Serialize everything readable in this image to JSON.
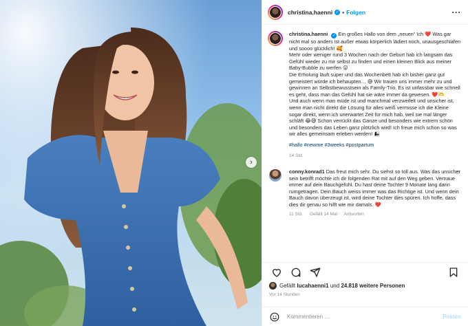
{
  "header": {
    "username": "christina.haenni",
    "separator": "•",
    "follow_label": "Folgen",
    "more_label": "···"
  },
  "caption": {
    "username": "christina.haenni",
    "paragraphs": [
      "Ein großes Hallo von dem „neuen“ Ich ❤️ Was gar nicht mal so anders ist außer etwas körperlich lädiert noch, unausgeschlafen und soooo glücklich! 🥰",
      "Mehr oder weniger rund 3 Wochen nach der Geburt hab ich langsam das Gefühl wieder zu mir selbst zu finden und einen kleinen Blick aus meiner Baby-Bubble zu werfen 😛",
      "Die Erholung läuft super und das Wochenbett hab ich bisher ganz gut gemeistert würde ich behaupten… 😅 Wir trauen uns immer mehr zu und gewinnen an Selbstbewusstsein als Family-Trio. Es ist unfassbar wie schnell es geht, dass man das Gefühl hat sie wäre immer da gewesen. ❤️🫶",
      "Und auch wenn man müde ist und manchmal verzweifelt und unsicher ist, wenn man nicht direkt die Lösung für alles weiß vermisse ich die Kleine sogar direkt, wenn ich unerwartet Zeit für mich hab, weil sie mal länger schläft 😂😅 Schon verrückt das Ganze und besonders wie extrem schön und besonders das Leben ganz plötzlich wird! Ich freue mich schon so was wir alles gemeinsam erleben werden! 👩‍👧"
    ],
    "hashtags": [
      "#hallo",
      "#newme",
      "#3weeks",
      "#postpartum"
    ],
    "time": "14 Std."
  },
  "comment": {
    "username": "conny.konrad1",
    "text": "Das freut mich sehr. Du siehst so toll aus. Was das unsicher sein betrifft möchte ich dir folgenden Rat mit auf den Weg geben. Vertraue immer auf dein Bauchgefühl. Du hast deine Tochter 9 Monate lang darin rumgetragen. Dein Bauch weiss immer was das Richtige ist. Und wenn dein Bauch davon überzeugt ist, wird deine Tochter dies spüren. Ich hoffe, dass dies dir genau so hilft wie mir damals. ❤️",
    "time": "11 Std.",
    "likes": "Gefällt 14 Mal",
    "reply_label": "Antworten"
  },
  "likes": {
    "prefix": "Gefällt",
    "user": "lucahaenni1",
    "middle": "und",
    "count": "24.818 weitere Personen"
  },
  "posted": "Vor 14 Stunden",
  "add_comment": {
    "placeholder": "Kommentieren …",
    "post_label": "Posten"
  },
  "icons": {
    "verified": "verified-badge-icon",
    "like": "heart-icon",
    "comment": "comment-icon",
    "share": "share-icon",
    "save": "bookmark-icon",
    "emoji": "emoji-icon",
    "next": "chevron-right-icon"
  },
  "colors": {
    "accent": "#0095f6",
    "heart": "#ed4956",
    "link": "#00376b",
    "muted": "#8e8e8e"
  }
}
